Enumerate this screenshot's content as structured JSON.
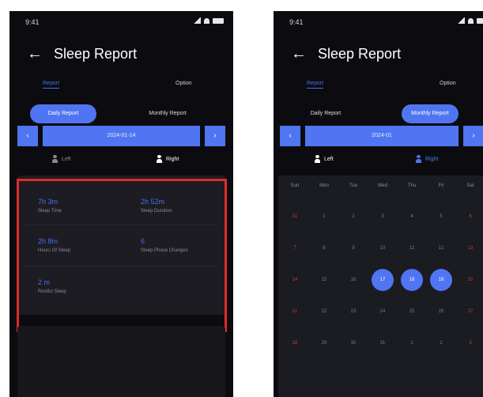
{
  "colors": {
    "accent": "#4f75f2",
    "background": "#0c0c10",
    "card": "#1c1c22",
    "highlight": "#e02b2b",
    "weekend": "#c33d3d"
  },
  "phone_left": {
    "status": {
      "time": "9:41"
    },
    "header": {
      "title": "Sleep Report",
      "back_icon": "arrow-left-icon"
    },
    "top_tabs": {
      "active": "Report",
      "inactive": "Option"
    },
    "segments": {
      "daily": "Daily Report",
      "monthly": "Monthly Report",
      "active": "daily"
    },
    "date": {
      "label": "2024-01-14",
      "prev": "‹",
      "next": "›"
    },
    "sides": {
      "left": "Left",
      "right": "Right",
      "active": "right"
    },
    "metrics": {
      "rows": [
        [
          {
            "value": "7h 3m",
            "label": "Sleep Time"
          },
          {
            "value": "2h 52m",
            "label": "Sleep Duration"
          }
        ],
        [
          {
            "value": "2h 8m",
            "label": "Hours Of Sleep"
          },
          {
            "value": "6",
            "label": "Sleep Phase Changes"
          }
        ],
        [
          {
            "value": "2 m",
            "label": "Restful Sleep"
          }
        ]
      ]
    }
  },
  "phone_right": {
    "status": {
      "time": "9:41"
    },
    "header": {
      "title": "Sleep Report",
      "back_icon": "arrow-left-icon"
    },
    "top_tabs": {
      "active": "Report",
      "inactive": "Option"
    },
    "segments": {
      "daily": "Daily Report",
      "monthly": "Monthly Report",
      "active": "monthly"
    },
    "date": {
      "label": "2024-01",
      "prev": "‹",
      "next": "›"
    },
    "sides": {
      "left": "Left",
      "right": "Right",
      "active": "right"
    },
    "calendar": {
      "weekdays": [
        "Sun",
        "Mon",
        "Tue",
        "Wed",
        "Thu",
        "Fri",
        "Sat"
      ],
      "weeks": [
        [
          "31",
          "1",
          "2",
          "3",
          "4",
          "5",
          "6"
        ],
        [
          "7",
          "8",
          "9",
          "10",
          "11",
          "12",
          "13"
        ],
        [
          "14",
          "15",
          "16",
          "17",
          "18",
          "19",
          "20"
        ],
        [
          "21",
          "22",
          "23",
          "24",
          "25",
          "26",
          "27"
        ],
        [
          "28",
          "29",
          "30",
          "31",
          "1",
          "2",
          "3"
        ]
      ],
      "selected": [
        "17",
        "18",
        "19"
      ]
    }
  }
}
